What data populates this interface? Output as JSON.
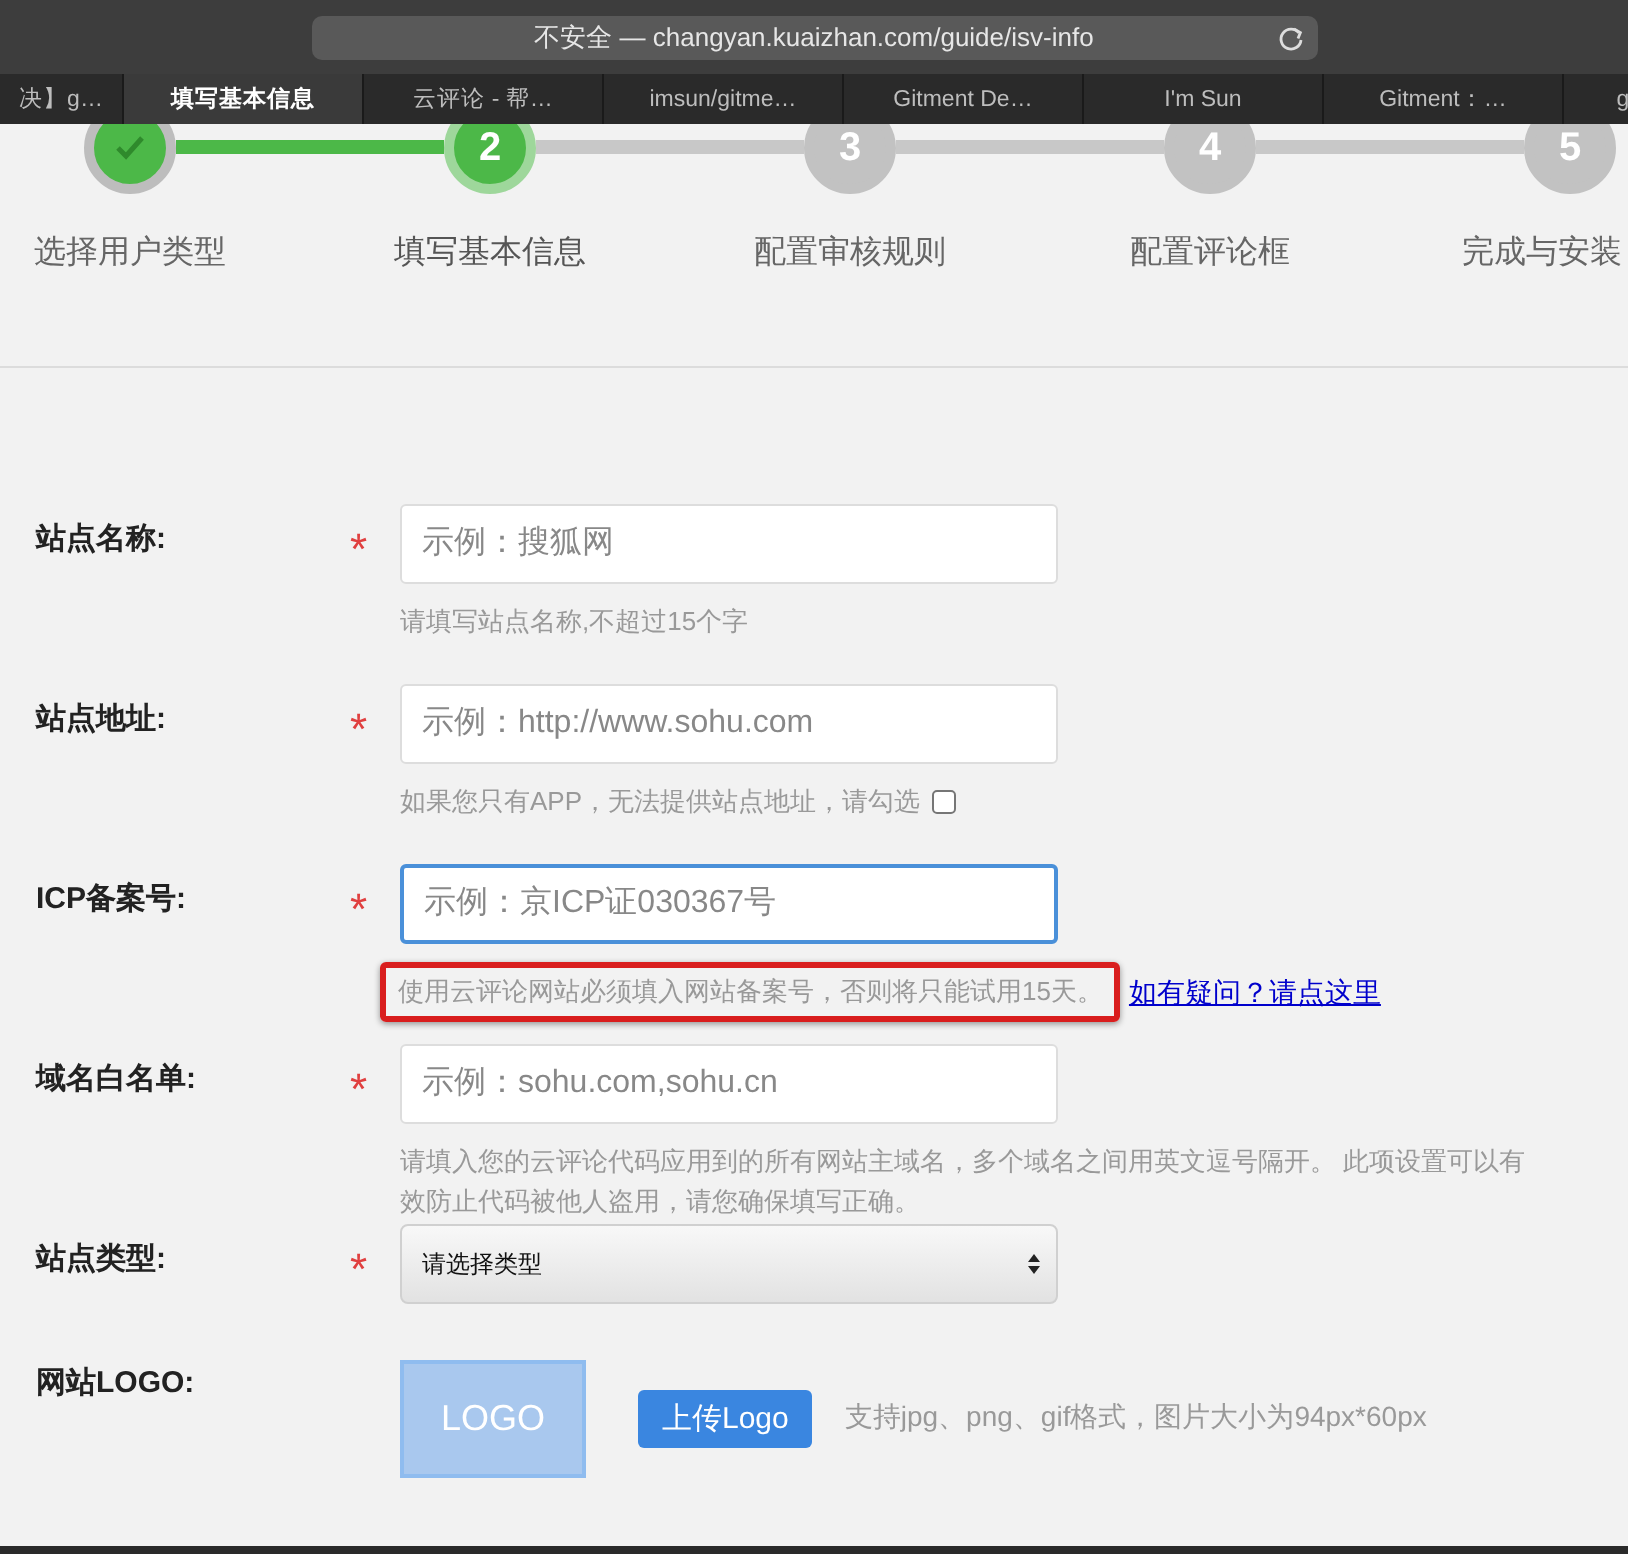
{
  "address_bar": {
    "url": "不安全 — changyan.kuaizhan.com/guide/isv-info"
  },
  "tabs": [
    {
      "label": "决】g…",
      "selected": false
    },
    {
      "label": "填写基本信息",
      "selected": true
    },
    {
      "label": "云评论 - 帮…",
      "selected": false
    },
    {
      "label": "imsun/gitme…",
      "selected": false
    },
    {
      "label": "Gitment De…",
      "selected": false
    },
    {
      "label": "I'm Sun",
      "selected": false
    },
    {
      "label": "Gitment：…",
      "selected": false
    },
    {
      "label": "g",
      "selected": false
    }
  ],
  "steps": [
    {
      "label": "选择用户类型",
      "done": true,
      "selected": false
    },
    {
      "number": "2",
      "label": "填写基本信息",
      "done": false,
      "selected": true
    },
    {
      "number": "3",
      "label": "配置审核规则",
      "done": false,
      "selected": false
    },
    {
      "number": "4",
      "label": "配置评论框",
      "done": false,
      "selected": false
    },
    {
      "number": "5",
      "label": "完成与安装",
      "done": false,
      "selected": false
    }
  ],
  "form": [
    {
      "kind": "input",
      "label": "站点名称:",
      "required": "*",
      "placeholder": "示例：搜狐网",
      "focused": false,
      "hint": "请填写站点名称,不超过15个字"
    },
    {
      "kind": "input",
      "label": "站点地址:",
      "required": "*",
      "placeholder": "示例：http://www.sohu.com",
      "focused": false,
      "hint": "如果您只有APP，无法提供站点地址，请勾选",
      "checkbox": {
        "checked": false
      }
    },
    {
      "kind": "input",
      "label": "ICP备案号:",
      "required": "*",
      "placeholder": "示例：京ICP证030367号",
      "focused": true,
      "hint": "使用云评论网站必须填入网站备案号，否则将只能试用15天。",
      "hint_highlighted": true,
      "link": "如有疑问？请点这里"
    },
    {
      "kind": "input",
      "label": "域名白名单:",
      "required": "*",
      "placeholder": "示例：sohu.com,sohu.cn",
      "focused": false,
      "hint": "请填入您的云评论代码应用到的所有网站主域名，多个域名之间用英文逗号隔开。 此项设置可以有效防止代码被他人盗用，请您确保填写正确。"
    },
    {
      "kind": "select",
      "label": "站点类型:",
      "required": "*",
      "value": "请选择类型"
    },
    {
      "kind": "logo",
      "label": "网站LOGO:",
      "logo_text": "LOGO",
      "button": "上传Logo",
      "hint": "支持jpg、png、gif格式，图片大小为94px*60px"
    }
  ]
}
